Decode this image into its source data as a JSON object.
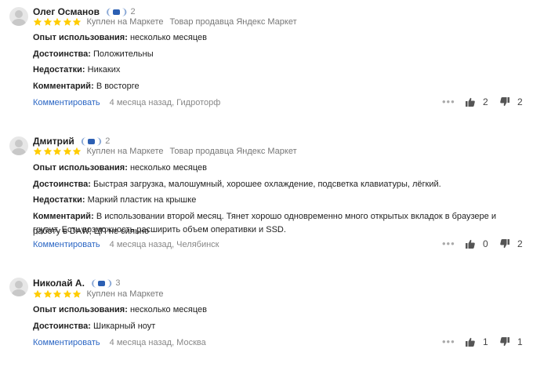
{
  "labels": {
    "experience": "Опыт использования:",
    "pros": "Достоинства:",
    "cons": "Недостатки:",
    "comment": "Комментарий:",
    "reply_link": "Комментировать",
    "more_dots": "•••"
  },
  "reviews": [
    {
      "author": "Олег Османов",
      "badge_count": "2",
      "rating": 5,
      "bought": "Куплен на Маркете",
      "seller": "Товар продавца Яндекс Маркет",
      "experience": "несколько месяцев",
      "pros": "Положительны",
      "cons": "Никаких",
      "comment": "В восторге",
      "date_city": "4 месяца назад, Гидроторф",
      "likes": "2",
      "dislikes": "2"
    },
    {
      "author": "Дмитрий",
      "badge_count": "2",
      "rating": 5,
      "bought": "Куплен на Маркете",
      "seller": "Товар продавца Яндекс Маркет",
      "experience": "несколько месяцев",
      "pros": "Быстрая загрузка, малошумный, хорошее охлаждение, подсветка клавиатуры, лёгкий.",
      "cons": "Маркий пластик на крышке",
      "comment_line1": "В использовании второй месяц. Тянет хорошо одновременно много открытых вкладок в браузере и работу в DAW, ЦП не сильно",
      "comment_line2": "грузит. Есть возможность расширить объем оперативки и SSD.",
      "date_city": "4 месяца назад, Челябинск",
      "likes": "0",
      "dislikes": "2"
    },
    {
      "author": "Николай А.",
      "badge_count": "3",
      "rating": 5,
      "bought": "Куплен на Маркете",
      "experience": "несколько месяцев",
      "pros": "Шикарный ноут",
      "date_city": "4 месяца назад, Москва",
      "likes": "1",
      "dislikes": "1"
    }
  ],
  "colors": {
    "star": "#fc0",
    "link": "#2b66c4",
    "badge": "#2b5fb3"
  }
}
